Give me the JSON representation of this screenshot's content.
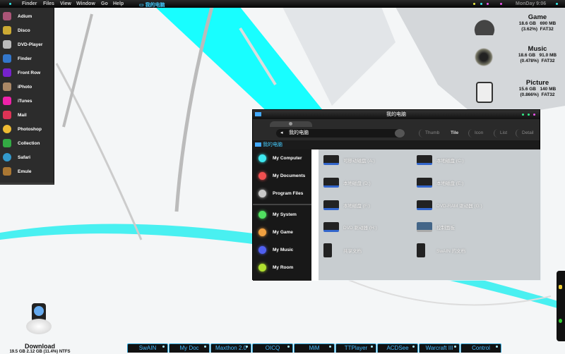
{
  "menubar": {
    "items": [
      "Finder",
      "Files",
      "View",
      "Window",
      "Go",
      "Help"
    ],
    "active_window": "我的电脑",
    "clock": "MonDay 9:06"
  },
  "dock": {
    "items": [
      "Adium",
      "Disco",
      "DVD-Player",
      "Finder",
      "Front Row",
      "iPhoto",
      "iTunes",
      "Mail",
      "Photoshop",
      "Collection",
      "Safari",
      "Emule"
    ]
  },
  "drives": [
    {
      "name": "Game",
      "free": "18.6 GB",
      "used": "690 MB",
      "pct": "(3.62%)",
      "fs": "FAT32"
    },
    {
      "name": "Music",
      "free": "18.6 GB",
      "used": "91.0 MB",
      "pct": "(0.478%)",
      "fs": "FAT32"
    },
    {
      "name": "Picture",
      "free": "15.6 GB",
      "used": "140 MB",
      "pct": "(0.866%)",
      "fs": "FAT32"
    }
  ],
  "window": {
    "title": "我的电脑",
    "address": "我的电脑",
    "path": "我的电脑",
    "views": [
      "Thumb",
      "Tile",
      "Icon",
      "List",
      "Detail"
    ],
    "sidebar": [
      {
        "label": "My Computer",
        "color": "#3ee8f0"
      },
      {
        "label": "My Documents",
        "color": "#f05050"
      },
      {
        "label": "Program Files",
        "color": "#c8c8c8"
      },
      {
        "label": "My System",
        "color": "#50e060"
      },
      {
        "label": "My Game",
        "color": "#f0a040"
      },
      {
        "label": "My Music",
        "color": "#5060f0"
      },
      {
        "label": "My Room",
        "color": "#b0e030"
      }
    ],
    "files": [
      "可移动磁盘 (A:)",
      "本地磁盘 (C:)",
      "本地磁盘 (D:)",
      "本地磁盘 (E:)",
      "本地磁盘 (F:)",
      "DVD-RAM 驱动器 (G:)",
      "DVD 驱动器 (H:)",
      "控制面板",
      "共享文档",
      "SwAIN 的文档"
    ]
  },
  "download": {
    "name": "Download",
    "info": "19.5 GB 2.12 GB (11.4%) NTFS"
  },
  "taskbar": [
    "SwAIN",
    "My Doc",
    "Maxthon 2.0",
    "OICQ",
    "MiM",
    "TTPlayer",
    "ACDSee",
    "Warcraft III",
    "Control"
  ]
}
